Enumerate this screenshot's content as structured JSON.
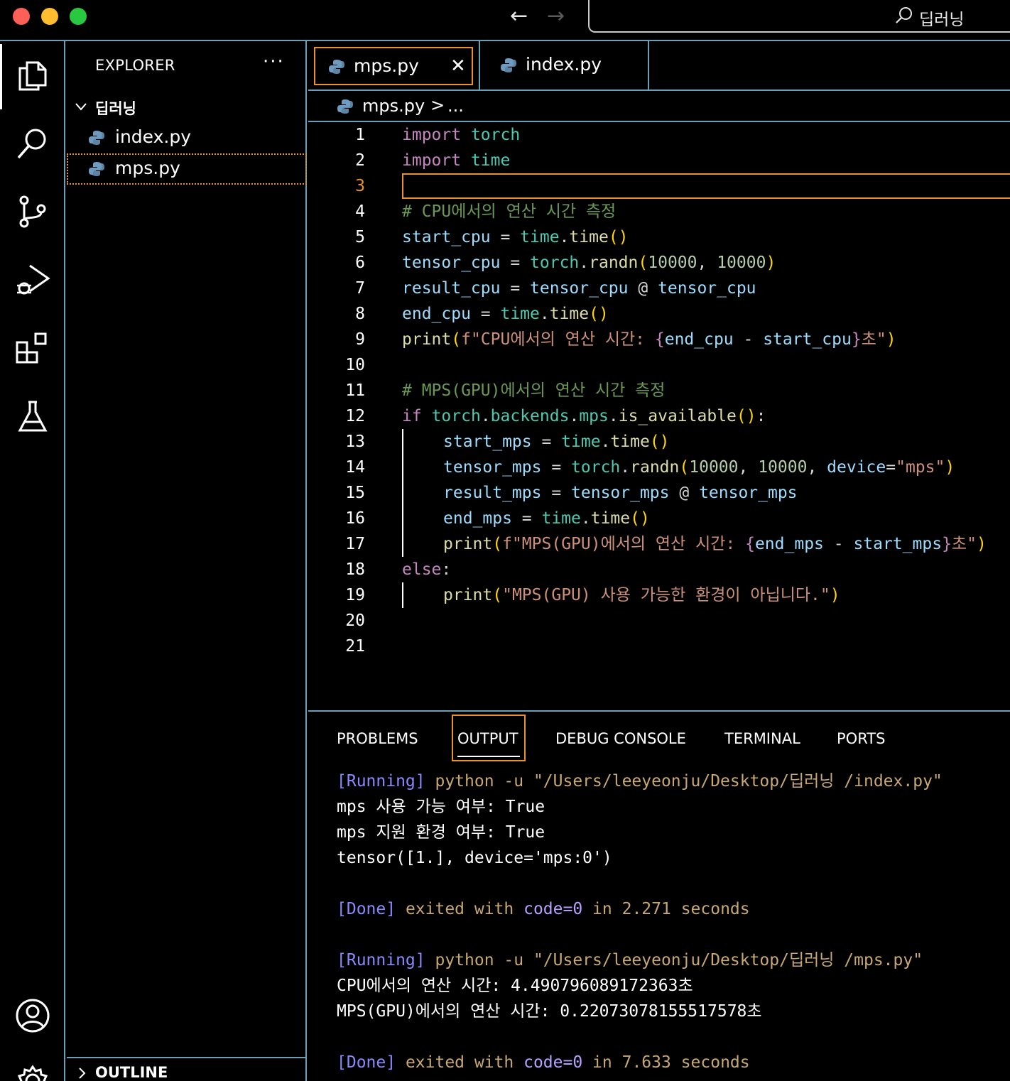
{
  "titlebar": {
    "search_text": "딥러닝",
    "nav_back_icon": "arrow-left-icon",
    "nav_forward_icon": "arrow-right-icon"
  },
  "activitybar": {
    "items": [
      "explorer-icon",
      "search-icon",
      "source-control-icon",
      "run-debug-icon",
      "extensions-icon",
      "testing-icon",
      "account-icon",
      "settings-icon"
    ]
  },
  "sidebar": {
    "title": "EXPLORER",
    "more": "···",
    "folder": "딥러닝",
    "files": [
      {
        "name": "index.py"
      },
      {
        "name": "mps.py"
      }
    ],
    "outline": "OUTLINE"
  },
  "tabs": [
    {
      "label": "mps.py",
      "active": true,
      "close": "✕"
    },
    {
      "label": "index.py",
      "active": false
    }
  ],
  "breadcrumb": {
    "file": "mps.py",
    "separator": ">",
    "more": "..."
  },
  "editor": {
    "active_line": 3,
    "lines": [
      {
        "n": "1"
      },
      {
        "n": "2"
      },
      {
        "n": "3"
      },
      {
        "n": "4"
      },
      {
        "n": "5"
      },
      {
        "n": "6"
      },
      {
        "n": "7"
      },
      {
        "n": "8"
      },
      {
        "n": "9"
      },
      {
        "n": "10"
      },
      {
        "n": "11"
      },
      {
        "n": "12"
      },
      {
        "n": "13"
      },
      {
        "n": "14"
      },
      {
        "n": "15"
      },
      {
        "n": "16"
      },
      {
        "n": "17"
      },
      {
        "n": "18"
      },
      {
        "n": "19"
      },
      {
        "n": "20"
      },
      {
        "n": "21"
      }
    ],
    "code": {
      "l1": [
        "import",
        " ",
        "torch"
      ],
      "l2": [
        "import",
        " ",
        "time"
      ],
      "l4": "# CPU에서의 연산 시간 측정",
      "l5": [
        "start_cpu",
        " = ",
        "time",
        ".",
        "time",
        "()"
      ],
      "l6": [
        "tensor_cpu",
        " = ",
        "torch",
        ".",
        "randn",
        "(",
        "10000",
        ", ",
        "10000",
        ")"
      ],
      "l7": [
        "result_cpu",
        " = ",
        "tensor_cpu",
        " @ ",
        "tensor_cpu"
      ],
      "l8": [
        "end_cpu",
        " = ",
        "time",
        ".",
        "time",
        "()"
      ],
      "l9": [
        "print",
        "(",
        "f\"CPU에서의 연산 시간: ",
        "{",
        "end_cpu",
        " - ",
        "start_cpu",
        "}",
        "초\"",
        ")"
      ],
      "l11": "# MPS(GPU)에서의 연산 시간 측정",
      "l12": [
        "if",
        " ",
        "torch",
        ".",
        "backends",
        ".",
        "mps",
        ".",
        "is_available",
        "()",
        ":"
      ],
      "l13": [
        "start_mps",
        " = ",
        "time",
        ".",
        "time",
        "()"
      ],
      "l14": [
        "tensor_mps",
        " = ",
        "torch",
        ".",
        "randn",
        "(",
        "10000",
        ", ",
        "10000",
        ", ",
        "device",
        "=",
        "\"mps\"",
        ")"
      ],
      "l15": [
        "result_mps",
        " = ",
        "tensor_mps",
        " @ ",
        "tensor_mps"
      ],
      "l16": [
        "end_mps",
        " = ",
        "time",
        ".",
        "time",
        "()"
      ],
      "l17": [
        "print",
        "(",
        "f\"MPS(GPU)에서의 연산 시간: ",
        "{",
        "end_mps",
        " - ",
        "start_mps",
        "}",
        "초\"",
        ")"
      ],
      "l18": [
        "else",
        ":"
      ],
      "l19": [
        "print",
        "(",
        "\"MPS(GPU) 사용 가능한 환경이 아닙니다.\"",
        ")"
      ]
    }
  },
  "panel": {
    "tabs": [
      "PROBLEMS",
      "OUTPUT",
      "DEBUG CONSOLE",
      "TERMINAL",
      "PORTS"
    ],
    "active_tab": "OUTPUT",
    "output": {
      "run1_tag": "[Running]",
      "run1_cmd": " python -u \"/Users/leeyeonju/Desktop/딥러닝 /index.py\"",
      "run1_out1": "mps 사용 가능 여부: True",
      "run1_out2": "mps 지원 환경 여부: True",
      "run1_out3": "tensor([1.], device='mps:0')",
      "done1_tag": "[Done]",
      "done1_a": " exited with ",
      "done1_code": "code=0",
      "done1_b": " in ",
      "done1_time": "2.271",
      "done1_c": " seconds",
      "run2_tag": "[Running]",
      "run2_cmd": " python -u \"/Users/leeyeonju/Desktop/딥러닝 /mps.py\"",
      "run2_out1": "CPU에서의 연산 시간: 4.490796089172363초",
      "run2_out2": "MPS(GPU)에서의 연산 시간: 0.22073078155517578초",
      "done2_tag": "[Done]",
      "done2_a": " exited with ",
      "done2_code": "code=0",
      "done2_b": " in ",
      "done2_time": "7.633",
      "done2_c": " seconds"
    }
  }
}
